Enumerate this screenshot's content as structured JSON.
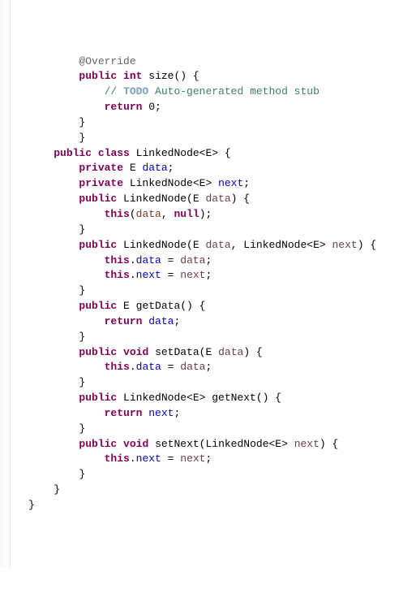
{
  "code": {
    "l1": {
      "ind": "        ",
      "ann": "@Override"
    },
    "l2": {
      "ind": "        ",
      "kw1": "public",
      "sp1": " ",
      "kw2": "int",
      "sp2": " ",
      "id": "size() {"
    },
    "l3": {
      "ind": "            ",
      "c1": "// ",
      "todo": "TODO",
      "c2": " Auto-generated method stub"
    },
    "l4": {
      "ind": "            ",
      "kw": "return",
      "rest": " 0;"
    },
    "l5": {
      "ind": "        ",
      "t": "}"
    },
    "l6": {
      "ind": "        ",
      "t": "}"
    },
    "l7": {
      "ind": "    ",
      "kw1": "public",
      "sp1": " ",
      "kw2": "class",
      "sp2": " ",
      "id": "LinkedNode<E> {"
    },
    "l8": {
      "ind": "        ",
      "kw": "private",
      "sp": " E ",
      "fld": "data",
      "rest": ";"
    },
    "l9": {
      "ind": "        ",
      "kw": "private",
      "sp": " LinkedNode<E> ",
      "fld": "next",
      "rest": ";"
    },
    "l10": "",
    "l11": {
      "ind": "        ",
      "kw": "public",
      "rest1": " LinkedNode(E ",
      "p": "data",
      "rest2": ") {"
    },
    "l12": {
      "ind": "            ",
      "kw": "this",
      "rest1": "(",
      "p": "data",
      "rest2": ", ",
      "kw2": "null",
      "rest3": ");"
    },
    "l13": {
      "ind": "        ",
      "t": "}"
    },
    "l14": "",
    "l15": {
      "ind": "        ",
      "kw": "public",
      "rest1": " LinkedNode(E ",
      "p1": "data",
      "rest2": ", LinkedNode<E> ",
      "p2": "next",
      "rest3": ") {"
    },
    "l16": {
      "ind": "            ",
      "kw": "this",
      "dot": ".",
      "fld": "data",
      "eq": " = ",
      "p": "data",
      "semi": ";"
    },
    "l17": {
      "ind": "            ",
      "kw": "this",
      "dot": ".",
      "fld": "next",
      "eq": " = ",
      "p": "next",
      "semi": ";"
    },
    "l18": {
      "ind": "        ",
      "t": "}"
    },
    "l19": "",
    "l20": {
      "ind": "        ",
      "kw": "public",
      "rest": " E getData() {"
    },
    "l21": {
      "ind": "            ",
      "kw": "return",
      "sp": " ",
      "fld": "data",
      "semi": ";"
    },
    "l22": {
      "ind": "        ",
      "t": "}"
    },
    "l23": "",
    "l24": {
      "ind": "        ",
      "kw1": "public",
      "sp": " ",
      "kw2": "void",
      "rest1": " setData(E ",
      "p": "data",
      "rest2": ") {"
    },
    "l25": {
      "ind": "            ",
      "kw": "this",
      "dot": ".",
      "fld": "data",
      "eq": " = ",
      "p": "data",
      "semi": ";"
    },
    "l26": {
      "ind": "        ",
      "t": "}"
    },
    "l27": "",
    "l28": {
      "ind": "        ",
      "kw": "public",
      "rest": " LinkedNode<E> getNext() {"
    },
    "l29": {
      "ind": "            ",
      "kw": "return",
      "sp": " ",
      "fld": "next",
      "semi": ";"
    },
    "l30": {
      "ind": "        ",
      "t": "}"
    },
    "l31": "",
    "l32": {
      "ind": "        ",
      "kw1": "public",
      "sp": " ",
      "kw2": "void",
      "rest1": " setNext(LinkedNode<E> ",
      "p": "next",
      "rest2": ") {"
    },
    "l33": {
      "ind": "            ",
      "kw": "this",
      "dot": ".",
      "fld": "next",
      "eq": " = ",
      "p": "next",
      "semi": ";"
    },
    "l34": {
      "ind": "        ",
      "t": "}"
    },
    "l35": {
      "ind": "    ",
      "t": "}"
    },
    "l36": "",
    "l37": {
      "ind": "",
      "t": "}"
    }
  }
}
